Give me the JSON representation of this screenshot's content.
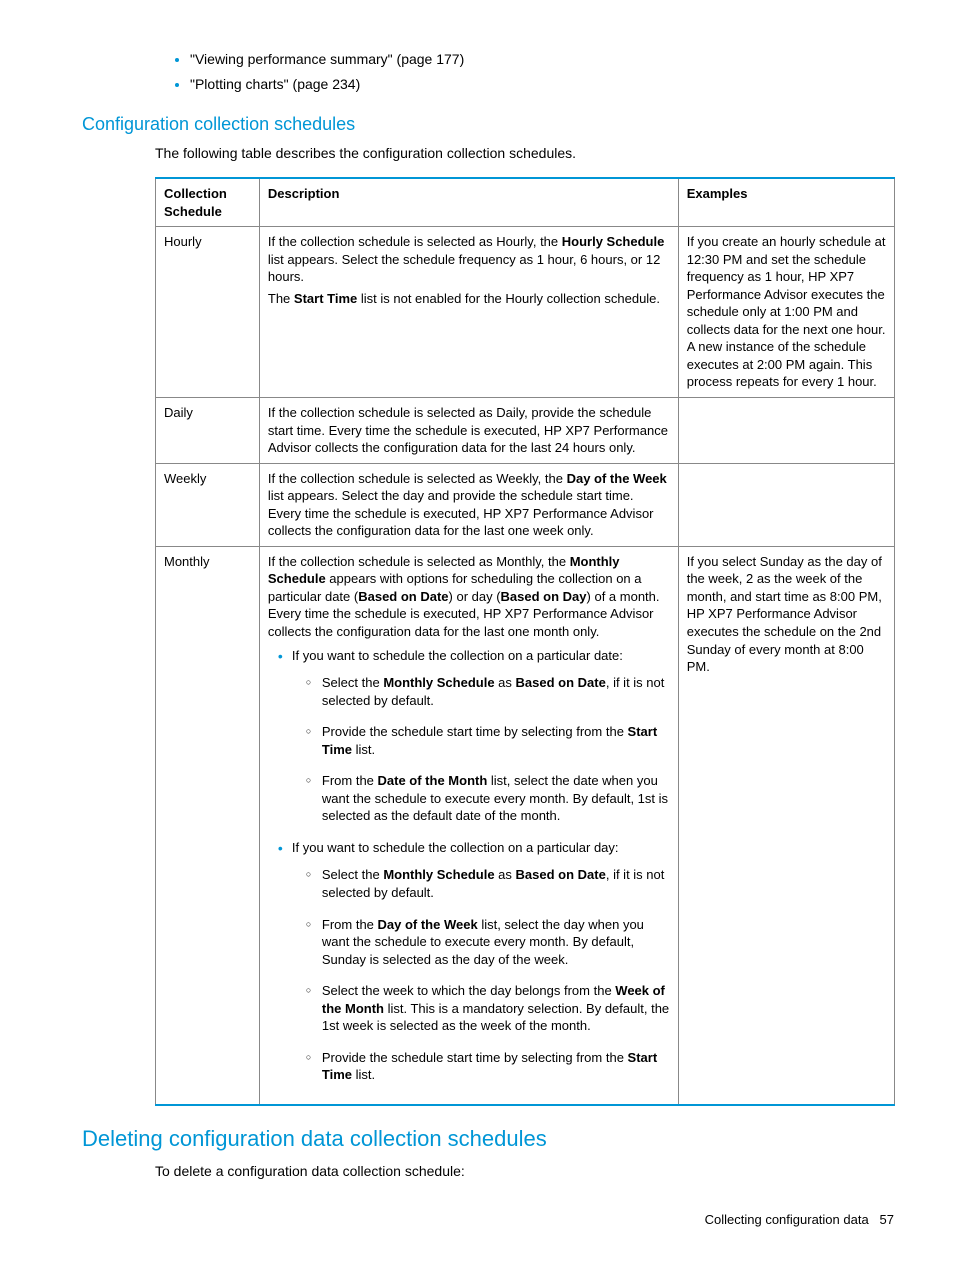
{
  "topLinks": [
    "\"Viewing performance summary\" (page 177)",
    "\"Plotting charts\" (page 234)"
  ],
  "section1": {
    "heading": "Configuration collection schedules",
    "intro": "The following table describes the configuration collection schedules."
  },
  "table": {
    "headers": {
      "c1": "Collection Schedule",
      "c2": "Description",
      "c3": "Examples"
    },
    "hourly": {
      "name": "Hourly",
      "desc1a": "If the collection schedule is selected as Hourly, the ",
      "desc1b": "Hourly Schedule",
      "desc1c": " list appears. Select the schedule frequency as 1 hour, 6 hours, or 12 hours.",
      "desc2a": "The ",
      "desc2b": "Start Time",
      "desc2c": " list is not enabled for the Hourly collection schedule.",
      "ex": "If you create an hourly schedule at 12:30 PM and set the schedule frequency as 1 hour, HP XP7 Performance Advisor executes the schedule only at 1:00 PM and collects data for the next one hour. A new instance of the schedule executes at 2:00 PM again. This process repeats for every 1 hour."
    },
    "daily": {
      "name": "Daily",
      "desc": "If the collection schedule is selected as Daily, provide the schedule start time. Every time the schedule is executed, HP XP7 Performance Advisor collects the configuration data for the last 24 hours only.",
      "ex": ""
    },
    "weekly": {
      "name": "Weekly",
      "desc1a": "If the collection schedule is selected as Weekly, the ",
      "desc1b": "Day of the Week",
      "desc1c": " list appears. Select the day and provide the schedule start time. Every time the schedule is executed, HP XP7 Performance Advisor collects the configuration data for the last one week only.",
      "ex": ""
    },
    "monthly": {
      "name": "Monthly",
      "p1a": "If the collection schedule is selected as Monthly, the ",
      "p1b": "Monthly Schedule",
      "p1c": " appears with options for scheduling the collection on a particular date (",
      "p1d": "Based on Date",
      "p1e": ") or day (",
      "p1f": "Based on Day",
      "p1g": ") of a month. Every time the schedule is executed, HP XP7 Performance Advisor collects the configuration data for the last one month only.",
      "b1": "If you want to schedule the collection on a particular date:",
      "b1s1a": "Select the ",
      "b1s1b": "Monthly Schedule",
      "b1s1c": " as ",
      "b1s1d": "Based on Date",
      "b1s1e": ", if it is not selected by default.",
      "b1s2a": "Provide the schedule start time by selecting from the ",
      "b1s2b": "Start Time",
      "b1s2c": " list.",
      "b1s3a": "From the ",
      "b1s3b": "Date of the Month",
      "b1s3c": " list, select the date when you want the schedule to execute every month. By default, 1st is selected as the default date of the month.",
      "b2": "If you want to schedule the collection on a particular day:",
      "b2s1a": "Select the ",
      "b2s1b": "Monthly Schedule",
      "b2s1c": " as ",
      "b2s1d": "Based on Date",
      "b2s1e": ", if it is not selected by default.",
      "b2s2a": "From the ",
      "b2s2b": "Day of the Week",
      "b2s2c": " list, select the day when you want the schedule to execute every month. By default, Sunday is selected as the day of the week.",
      "b2s3a": "Select the week to which the day belongs from the ",
      "b2s3b": "Week of the Month",
      "b2s3c": " list. This is a mandatory selection. By default, the 1st week is selected as the week of the month.",
      "b2s4a": "Provide the schedule start time by selecting from the ",
      "b2s4b": "Start Time",
      "b2s4c": " list.",
      "ex": "If you select Sunday as the day of the week, 2 as the week of the month, and start time as 8:00 PM, HP XP7 Performance Advisor executes the schedule on the 2nd Sunday of every month at 8:00 PM."
    }
  },
  "section2": {
    "heading": "Deleting configuration data collection schedules",
    "intro": "To delete a configuration data collection schedule:"
  },
  "footer": {
    "label": "Collecting configuration data",
    "page": "57"
  }
}
